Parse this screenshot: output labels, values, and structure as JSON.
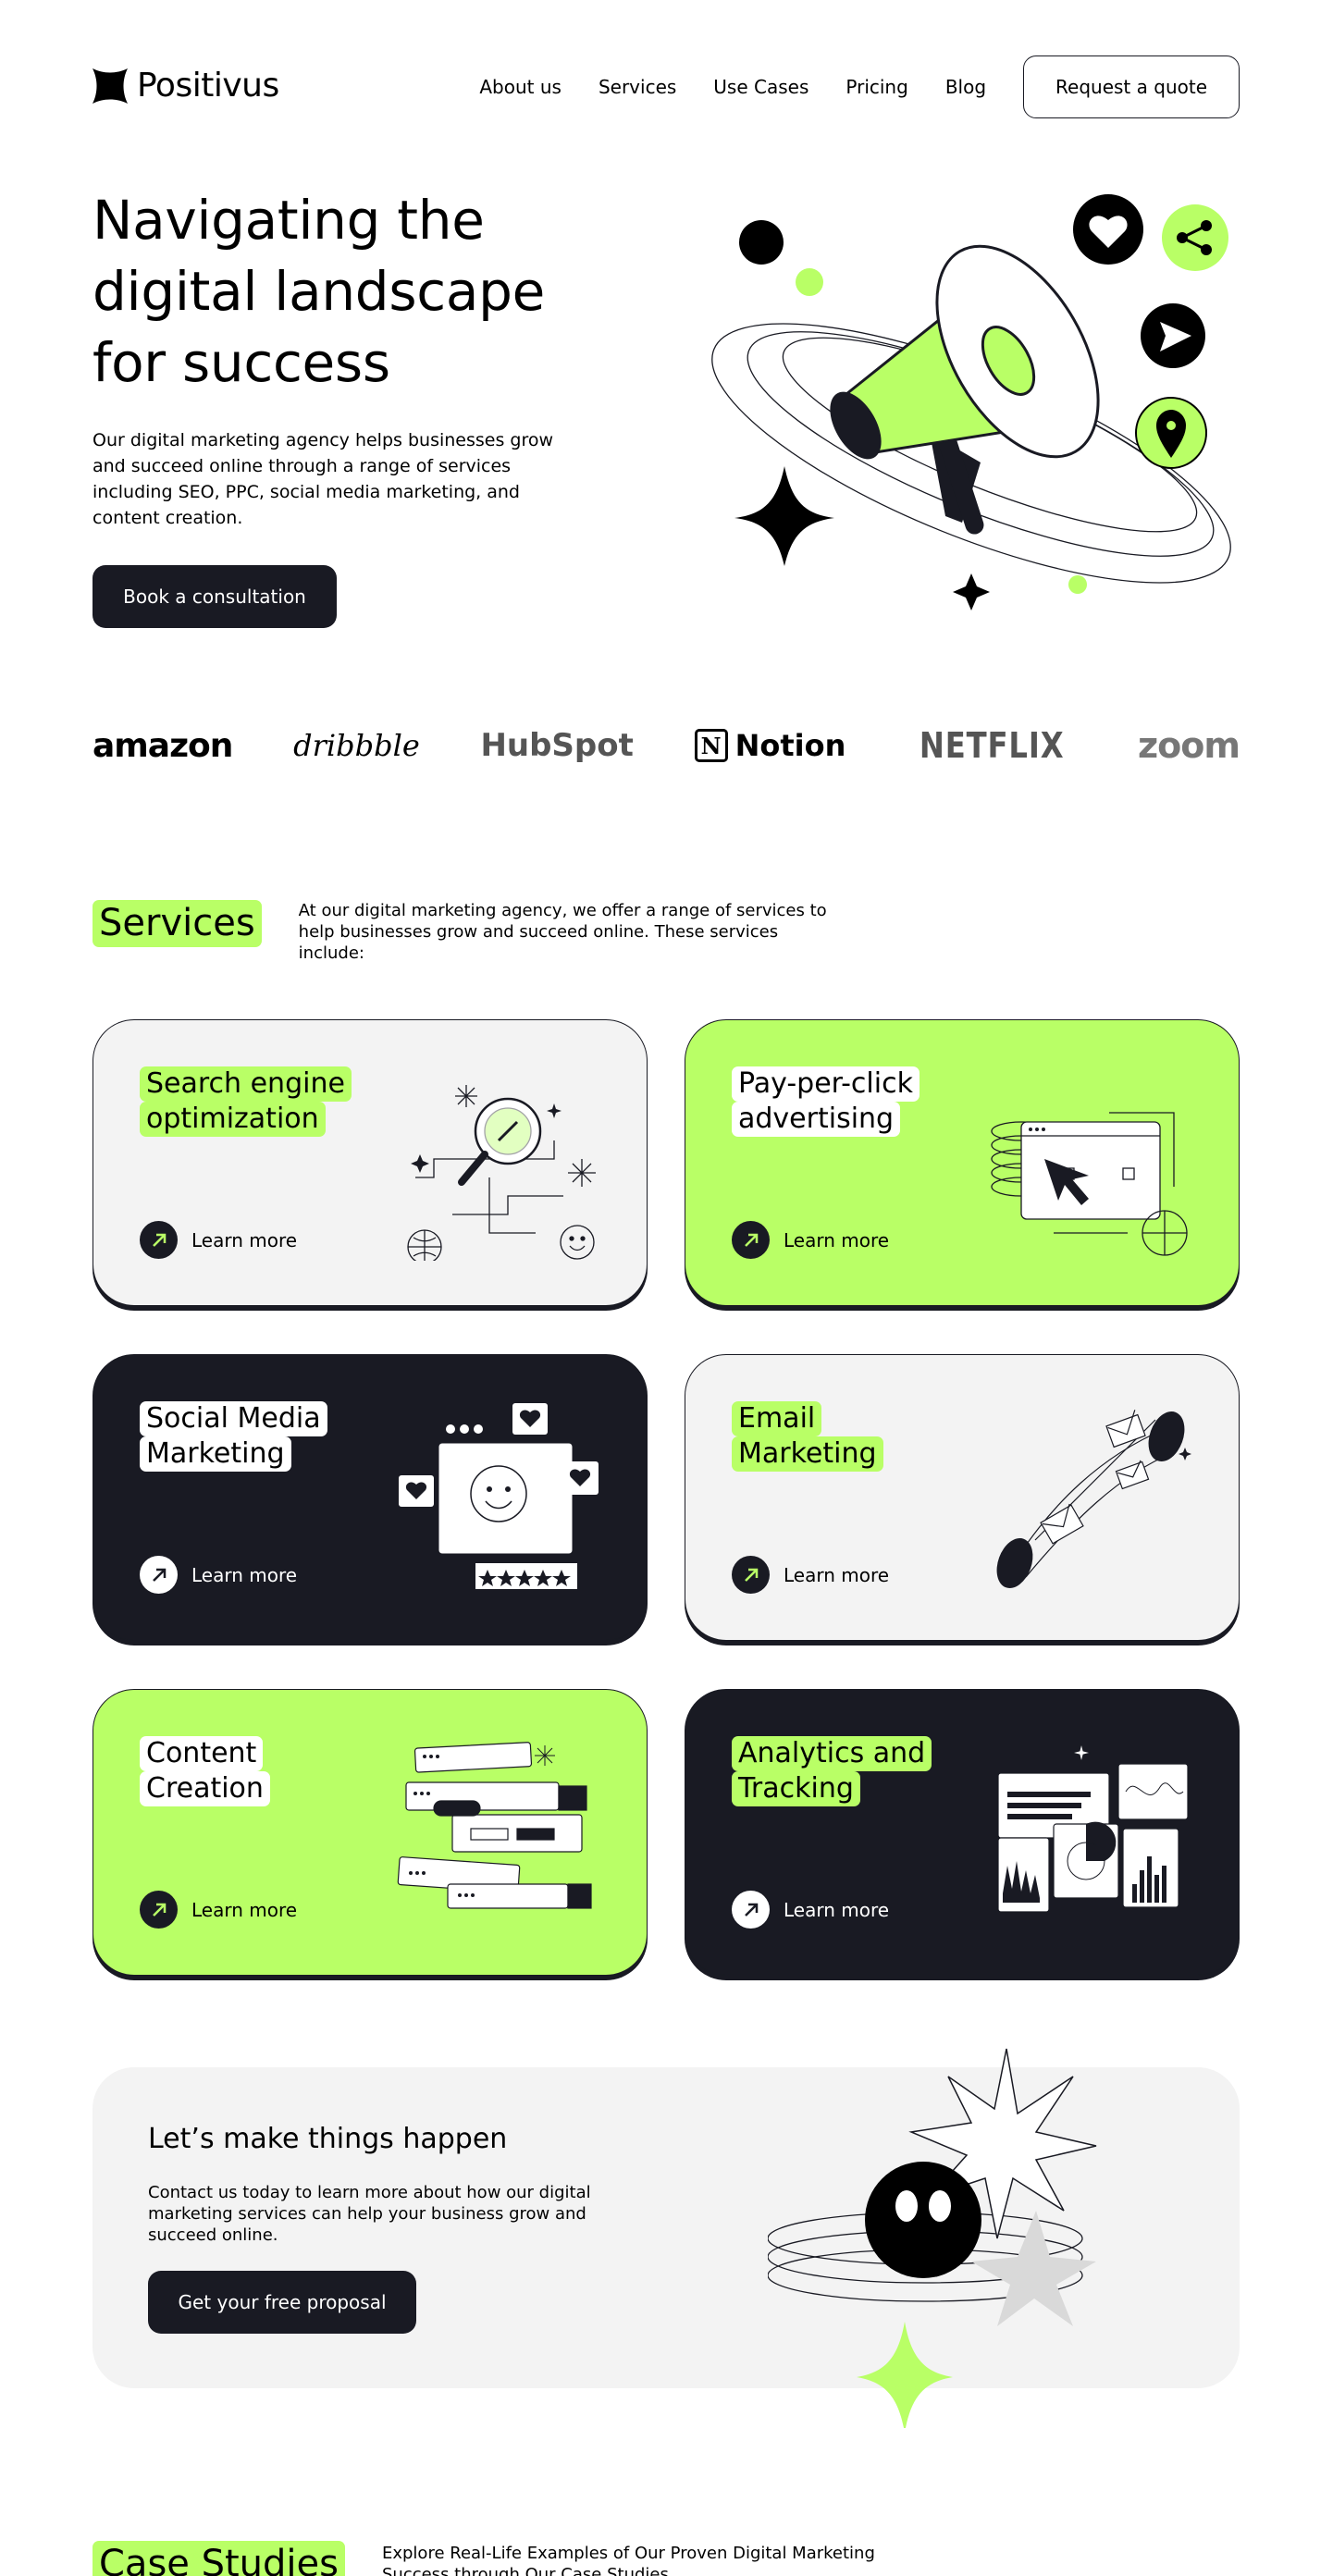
{
  "brand": {
    "name": "Positivus",
    "accent": "#b9ff66",
    "dark": "#191a23",
    "grey": "#f3f3f3"
  },
  "nav": {
    "items": [
      "About us",
      "Services",
      "Use Cases",
      "Pricing",
      "Blog"
    ],
    "cta": "Request a quote"
  },
  "hero": {
    "title": "Navigating the digital landscape for success",
    "description": "Our digital marketing agency helps businesses grow and succeed online through a range of services including SEO, PPC, social media marketing, and content creation.",
    "button": "Book a consultation"
  },
  "logos": [
    "amazon",
    "dribbble",
    "HubSpot",
    "Notion",
    "NETFLIX",
    "zoom"
  ],
  "services": {
    "tag": "Services",
    "description": "At our digital marketing agency, we offer a range of services to help businesses grow and succeed online. These services include:",
    "link_label": "Learn more",
    "cards": [
      {
        "line1": "Search engine",
        "line2": "optimization",
        "theme": "grey",
        "icon": "seo-magnifier-icon"
      },
      {
        "line1": "Pay-per-click",
        "line2": "advertising",
        "theme": "green",
        "icon": "ppc-cursor-icon"
      },
      {
        "line1": "Social Media",
        "line2": "Marketing",
        "theme": "dark",
        "icon": "social-smiley-icon"
      },
      {
        "line1": "Email",
        "line2": "Marketing",
        "theme": "grey",
        "icon": "email-envelope-icon"
      },
      {
        "line1": "Content",
        "line2": "Creation",
        "theme": "green",
        "icon": "content-windows-icon"
      },
      {
        "line1": "Analytics and",
        "line2": "Tracking",
        "theme": "dark",
        "icon": "analytics-charts-icon"
      }
    ]
  },
  "cta": {
    "title": "Let’s make things happen",
    "description": "Contact us today to learn more about how our digital marketing services can help your business grow and succeed online.",
    "button": "Get your free proposal"
  },
  "case_studies": {
    "tag": "Case Studies",
    "description": "Explore Real-Life Examples of Our Proven Digital Marketing Success through Our Case Studies"
  }
}
